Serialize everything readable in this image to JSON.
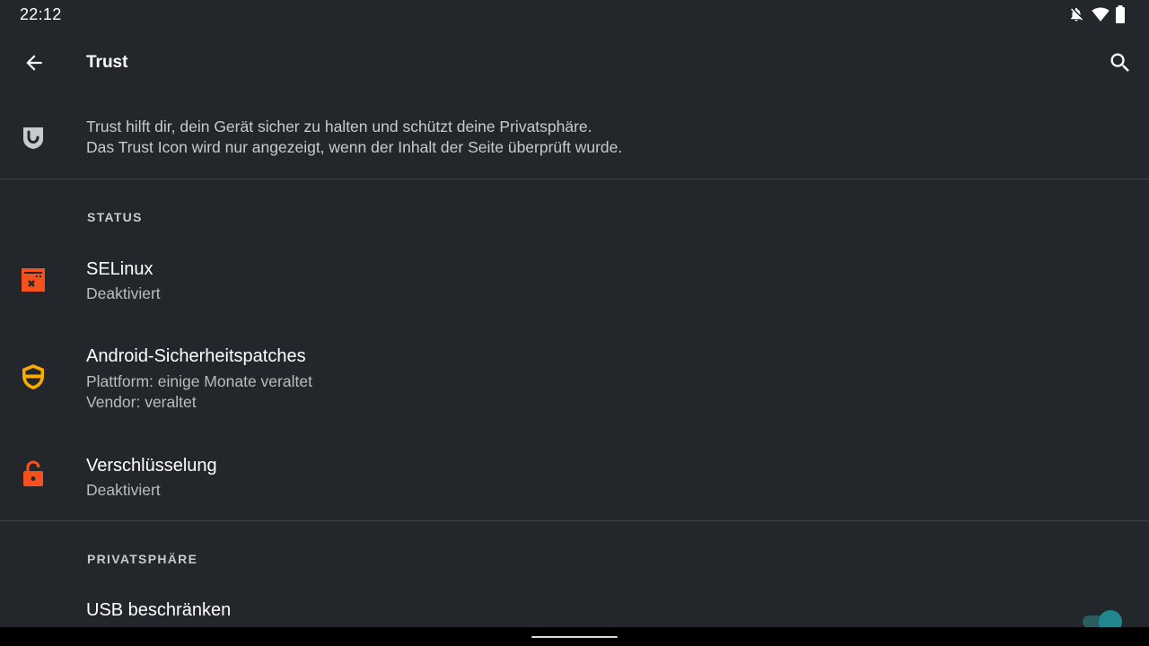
{
  "status_bar": {
    "time": "22:12",
    "icons": [
      "notifications-off-icon",
      "wifi-icon",
      "battery-icon"
    ]
  },
  "toolbar": {
    "title": "Trust",
    "back_icon": "arrow-back-icon",
    "search_icon": "search-icon"
  },
  "intro": {
    "icon": "trust-shield-icon",
    "line1": "Trust hilft dir, dein Gerät sicher zu halten und schützt deine Privatsphäre.",
    "line2": "Das Trust Icon wird nur angezeigt, wenn der Inhalt der Seite überprüft wurde."
  },
  "sections": {
    "status": {
      "header": "STATUS",
      "items": [
        {
          "icon": "selinux-disabled-icon",
          "title": "SELinux",
          "subtitle": "Deaktiviert",
          "icon_color": "#f4511e"
        },
        {
          "icon": "security-patch-icon",
          "title": "Android-Sicherheitspatches",
          "subtitle": "Plattform: einige Monate veraltet",
          "subtitle2": "Vendor: veraltet",
          "icon_color": "#f9ab00"
        },
        {
          "icon": "lock-open-icon",
          "title": "Verschlüsselung",
          "subtitle": "Deaktiviert",
          "icon_color": "#f4511e"
        }
      ]
    },
    "privacy": {
      "header": "PRIVATSPHÄRE",
      "items": [
        {
          "title": "USB beschränken",
          "toggle_on": true
        }
      ]
    }
  },
  "colors": {
    "background": "#23272b",
    "accent": "#21868f",
    "warning": "#f9ab00",
    "error": "#f4511e"
  }
}
